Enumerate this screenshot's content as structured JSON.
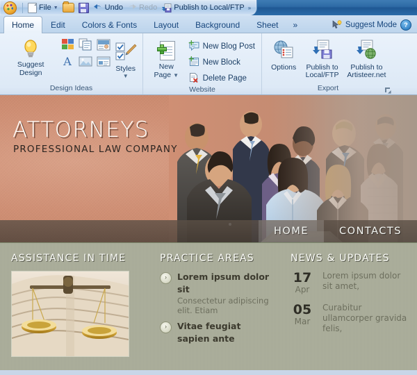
{
  "titlebar": {
    "app_icon": "artisteer-palette-icon",
    "items": [
      {
        "id": "file",
        "label": "File",
        "icon": "document-icon",
        "caret": true,
        "dim": false
      },
      {
        "id": "open",
        "label": "",
        "icon": "folder-open-icon",
        "caret": false,
        "dim": false
      },
      {
        "id": "save",
        "label": "",
        "icon": "floppy-save-icon",
        "caret": false,
        "dim": false
      },
      {
        "id": "undo",
        "label": "Undo",
        "icon": "undo-arrow-icon",
        "caret": false,
        "dim": false
      },
      {
        "id": "redo",
        "label": "Redo",
        "icon": "redo-arrow-icon",
        "caret": false,
        "dim": true
      },
      {
        "id": "publish",
        "label": "Publish to Local/FTP",
        "icon": "publish-ftp-icon",
        "caret": false,
        "dim": false
      }
    ],
    "overflow": "»"
  },
  "ribbon": {
    "tabs": [
      {
        "id": "home",
        "label": "Home",
        "active": true
      },
      {
        "id": "edit",
        "label": "Edit",
        "active": false
      },
      {
        "id": "colors-fonts",
        "label": "Colors & Fonts",
        "active": false
      },
      {
        "id": "layout",
        "label": "Layout",
        "active": false
      },
      {
        "id": "background",
        "label": "Background",
        "active": false
      },
      {
        "id": "sheet",
        "label": "Sheet",
        "active": false
      }
    ],
    "more_tabs": "»",
    "suggest_mode_label": "Suggest Mode",
    "help_label": "?",
    "groups": [
      {
        "id": "design-ideas",
        "label": "Design Ideas",
        "suggest_design_label": "Suggest Design",
        "small_icons": [
          {
            "id": "colors",
            "name": "color-swatches-icon"
          },
          {
            "id": "pages",
            "name": "copy-pages-icon"
          },
          {
            "id": "header",
            "name": "header-image-icon"
          },
          {
            "id": "fonts",
            "name": "font-letter-icon"
          },
          {
            "id": "picture",
            "name": "picture-icon"
          },
          {
            "id": "content",
            "name": "content-layout-icon"
          }
        ],
        "styles_label": "Styles"
      },
      {
        "id": "website",
        "label": "Website",
        "new_page_label_line1": "New",
        "new_page_label_line2": "Page",
        "items": [
          {
            "id": "new-blog-post",
            "label": "New Blog Post",
            "icon": "new-blog-post-icon"
          },
          {
            "id": "new-block",
            "label": "New Block",
            "icon": "new-block-icon"
          },
          {
            "id": "delete-page",
            "label": "Delete Page",
            "icon": "delete-page-icon"
          }
        ]
      },
      {
        "id": "export",
        "label": "Export",
        "buttons": [
          {
            "id": "options",
            "label": "Options",
            "icon": "options-globe-icon"
          },
          {
            "id": "publish-local-ftp",
            "label": "Publish to\nLocal/FTP",
            "label_line1": "Publish to",
            "label_line2": "Local/FTP",
            "icon": "publish-disk-icon"
          },
          {
            "id": "publish-artisteer",
            "label": "Publish to\nArtisteer.net",
            "label_line1": "Publish to",
            "label_line2": "Artisteer.net",
            "icon": "publish-web-icon"
          }
        ],
        "dialog_launcher": "⬌"
      }
    ]
  },
  "preview": {
    "banner": {
      "title": "ATTORNEYS",
      "tagline": "PROFESSIONAL LAW COMPANY",
      "photo_alt": "group-of-business-people-photo",
      "bg_color": "#cf8f74"
    },
    "nav": [
      {
        "id": "home",
        "label": "HOME",
        "selected": true
      },
      {
        "id": "contacts",
        "label": "CONTACTS",
        "selected": false
      }
    ],
    "columns": {
      "assistance": {
        "heading": "ASSISTANCE IN TIME",
        "image_alt": "scales-of-justice-on-books-photo"
      },
      "practice_areas": {
        "heading": "PRACTICE AREAS",
        "items": [
          {
            "title": "Lorem ipsum dolor sit",
            "text": "Consectetur adipiscing elit. Etiam",
            "bullet": "›"
          },
          {
            "title": "Vitae feugiat sapien ante",
            "text": "",
            "bullet": "›"
          }
        ]
      },
      "news": {
        "heading": "NEWS & UPDATES",
        "items": [
          {
            "day": "17",
            "month": "Apr",
            "text": "Lorem ipsum dolor sit amet,"
          },
          {
            "day": "05",
            "month": "Mar",
            "text": "Curabitur ullamcorper gravida felis,"
          }
        ]
      }
    },
    "content_bg": "#a9ac99"
  }
}
